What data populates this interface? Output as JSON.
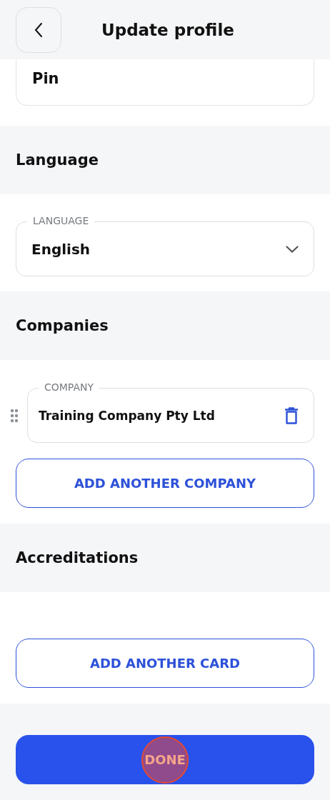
{
  "header": {
    "title": "Update profile"
  },
  "pin_field": {
    "value": "Pin"
  },
  "sections": [
    {
      "kind": "language",
      "heading": "Language",
      "field": {
        "label": "LANGUAGE",
        "value": "English"
      }
    },
    {
      "kind": "companies",
      "heading": "Companies",
      "companies": [
        {
          "label": "COMPANY",
          "value": "Training Company Pty Ltd"
        }
      ],
      "button": "ADD ANOTHER COMPANY"
    },
    {
      "kind": "accreditations",
      "heading": "Accreditations",
      "button": "ADD ANOTHER CARD"
    }
  ],
  "done_button": {
    "label": "DONE",
    "touched": true
  }
}
